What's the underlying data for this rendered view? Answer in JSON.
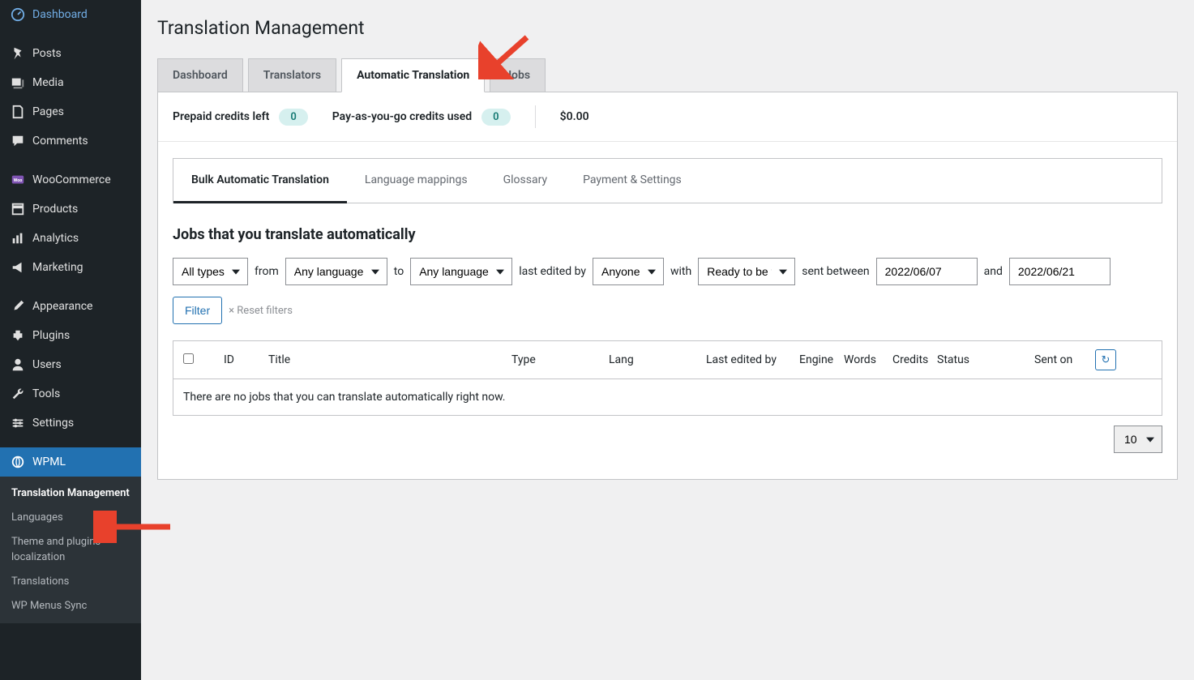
{
  "page_title": "Translation Management",
  "sidebar": {
    "items": [
      {
        "label": "Dashboard"
      },
      {
        "label": "Posts"
      },
      {
        "label": "Media"
      },
      {
        "label": "Pages"
      },
      {
        "label": "Comments"
      },
      {
        "label": "WooCommerce"
      },
      {
        "label": "Products"
      },
      {
        "label": "Analytics"
      },
      {
        "label": "Marketing"
      },
      {
        "label": "Appearance"
      },
      {
        "label": "Plugins"
      },
      {
        "label": "Users"
      },
      {
        "label": "Tools"
      },
      {
        "label": "Settings"
      },
      {
        "label": "WPML"
      }
    ],
    "submenu": [
      {
        "label": "Translation Management"
      },
      {
        "label": "Languages"
      },
      {
        "label": "Theme and plugins localization"
      },
      {
        "label": "Translations"
      },
      {
        "label": "WP Menus Sync"
      }
    ]
  },
  "primary_tabs": [
    "Dashboard",
    "Translators",
    "Automatic Translation",
    "Jobs"
  ],
  "credits": {
    "prepaid_label": "Prepaid credits left",
    "prepaid_value": "0",
    "payg_label": "Pay-as-you-go credits used",
    "payg_value": "0",
    "amount": "$0.00"
  },
  "sub_tabs": [
    "Bulk Automatic Translation",
    "Language mappings",
    "Glossary",
    "Payment & Settings"
  ],
  "section_title": "Jobs that you translate automatically",
  "filters": {
    "types_sel": "All types",
    "from_label": "from",
    "src_lang": "Any language",
    "to_label": "to",
    "dst_lang": "Any language",
    "last_edited_label": "last edited by",
    "editor_sel": "Anyone",
    "with_label": "with",
    "status_sel": "Ready to be t",
    "sent_label": "sent between",
    "date_from": "2022/06/07",
    "and_label": "and",
    "date_to": "2022/06/21",
    "filter_btn": "Filter",
    "reset_btn": "× Reset filters"
  },
  "table": {
    "headers": {
      "id": "ID",
      "title": "Title",
      "type": "Type",
      "lang": "Lang",
      "edited": "Last edited by",
      "eng": "Engine",
      "wo": "Words",
      "cre": "Credits",
      "status": "Status",
      "sent": "Sent on"
    },
    "empty_msg": "There are no jobs that you can translate automatically right now."
  },
  "pagination": {
    "per_page": "10"
  }
}
